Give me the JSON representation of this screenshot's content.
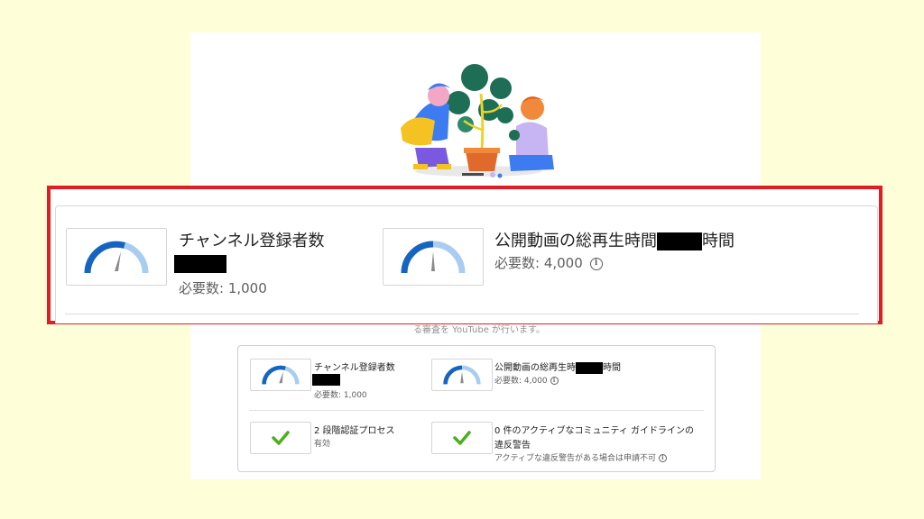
{
  "zoom": {
    "item1": {
      "title": "チャンネル登録者数",
      "required": "必要数: 1,000",
      "gauge_level": 0.55
    },
    "item2": {
      "title_prefix": "公開動画の総再生時間",
      "title_suffix": "時間",
      "required": "必要数: 4,000",
      "info_icon": "info-icon",
      "gauge_level": 0.5
    }
  },
  "partial_text": "る審査を YouTube が行います。",
  "card": {
    "item1": {
      "title": "チャンネル登録者数",
      "required": "必要数: 1,000"
    },
    "item2": {
      "title_prefix": "公開動画の総再生時",
      "title_suffix": "時間",
      "required": "必要数: 4,000"
    },
    "item3": {
      "title": "2 段階認証プロセス",
      "status": "有効",
      "icon": "check-icon"
    },
    "item4": {
      "title_line1": "0 件のアクティブなコミュニティ ガイドラインの",
      "title_line2": "違反警告",
      "note": "アクティブな違反警告がある場合は申請不可",
      "icon": "check-icon"
    }
  },
  "colors": {
    "background": "#fefed9",
    "highlight": "#e01d24",
    "gauge_blue": "#1565c0",
    "gauge_light": "#a9cdf0",
    "check_green": "#4caf1f"
  }
}
